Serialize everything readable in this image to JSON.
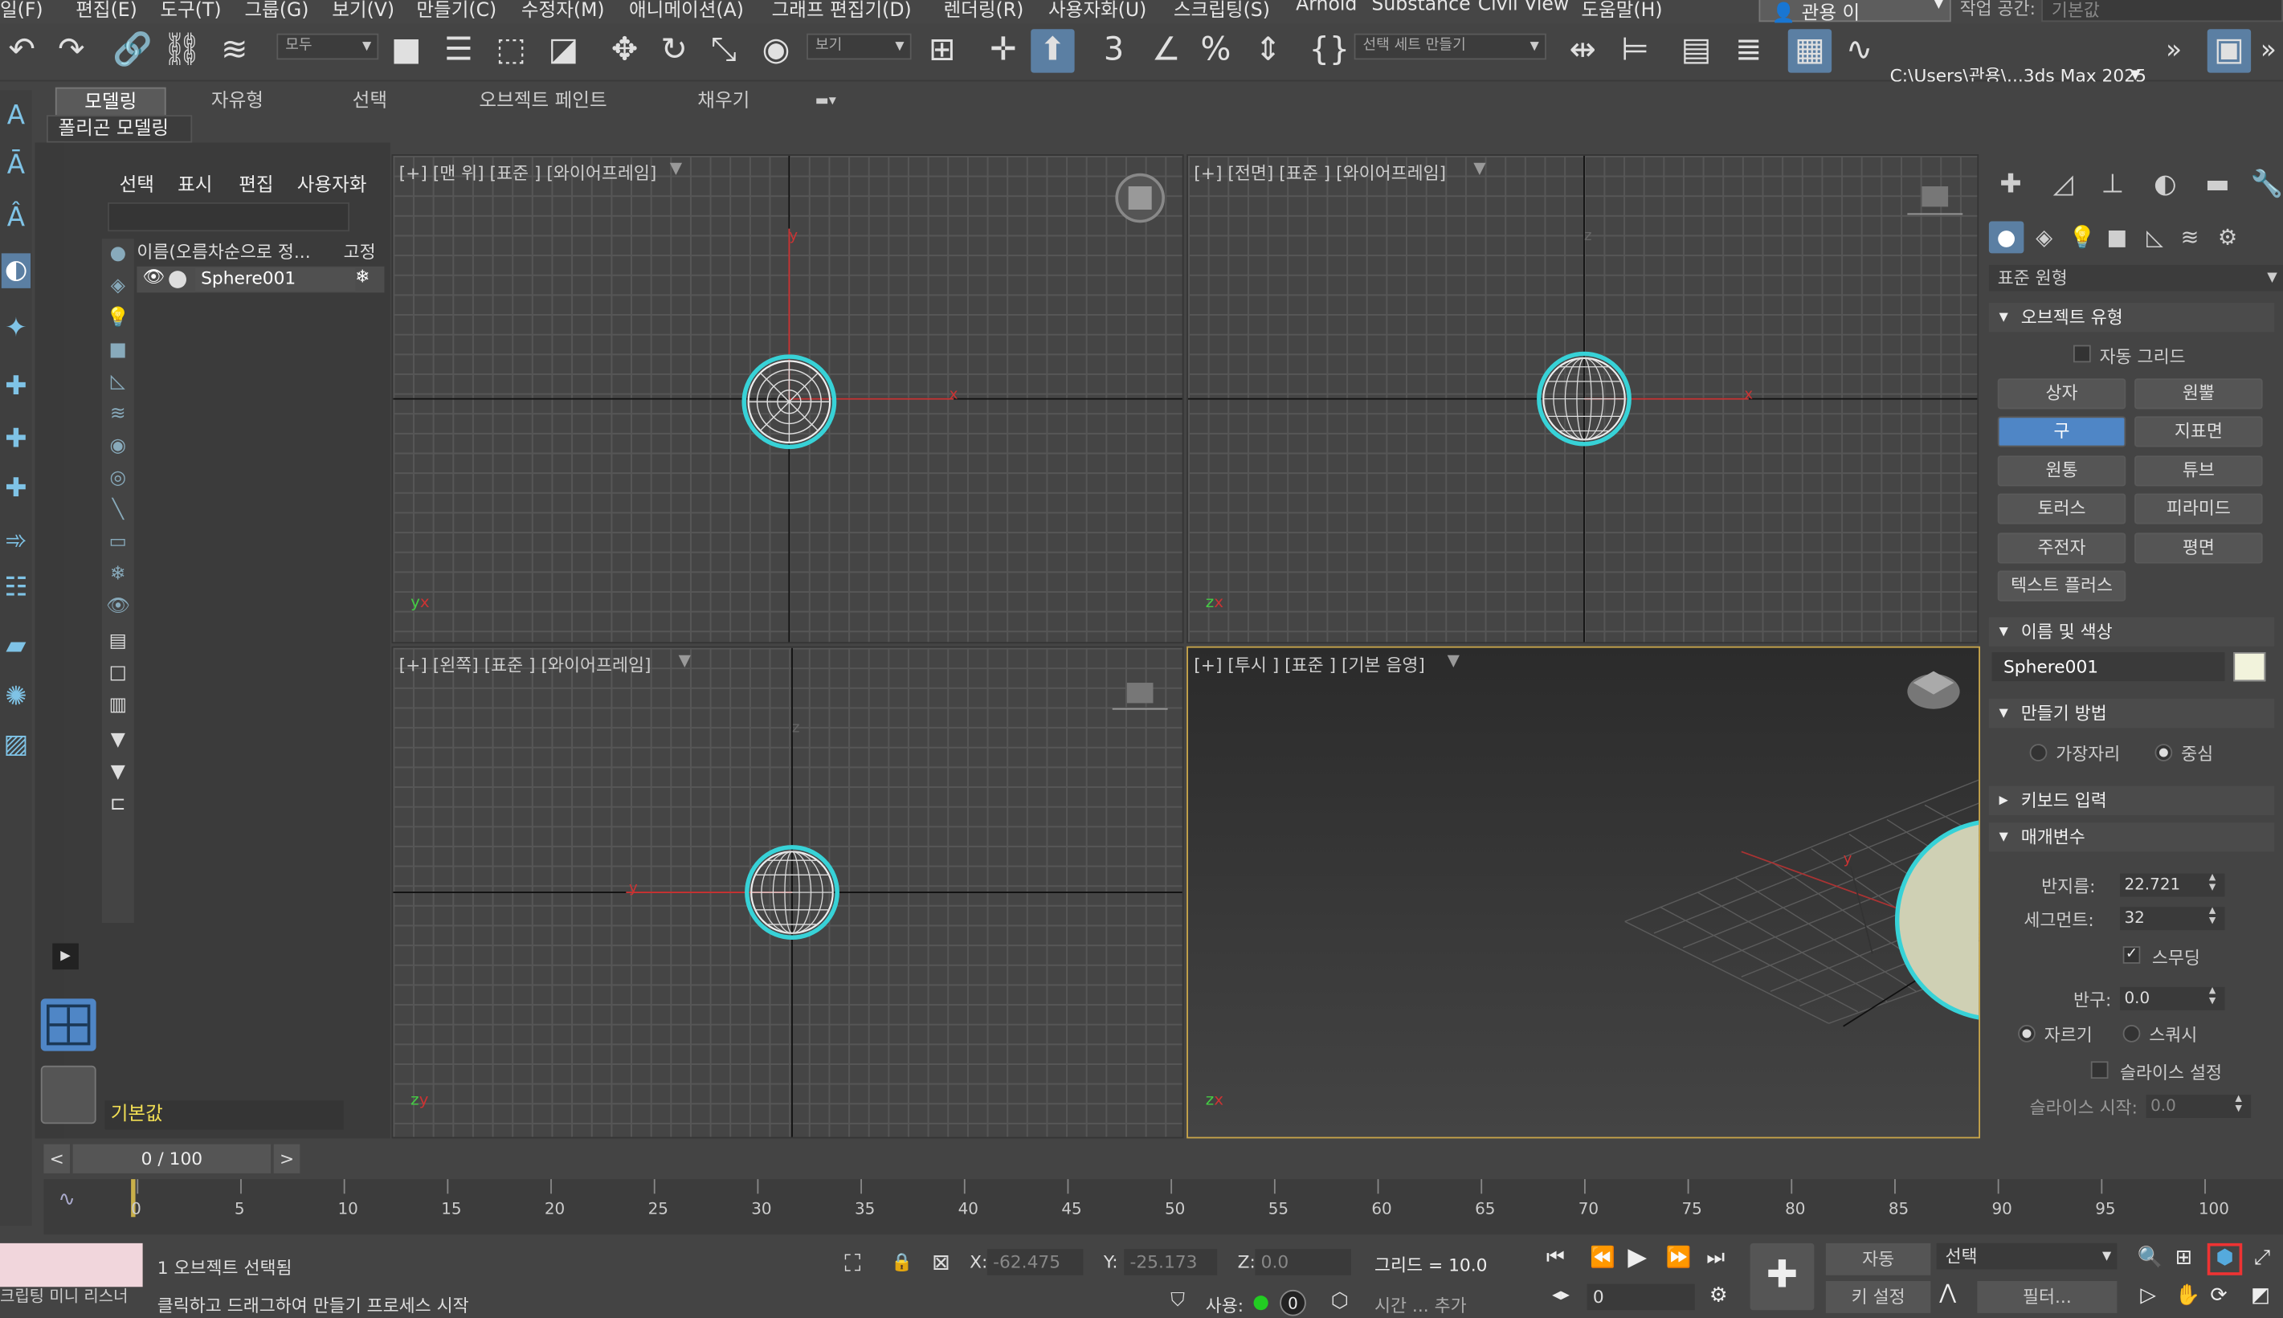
{
  "menubar": {
    "items": [
      "일(F)",
      "편집(E)",
      "도구(T)",
      "그룹(G)",
      "보기(V)",
      "만들기(C)",
      "수정자(M)",
      "애니메이션(A)",
      "그래프 편집기(D)",
      "렌더링(R)",
      "사용자화(U)",
      "스크립팅(S)",
      "Arnold",
      "Substance",
      "Civil View",
      "도움말(H)"
    ],
    "user": "관용 이",
    "workspace_label": "작업 공간:",
    "workspace_value": "기본값"
  },
  "toolbar": {
    "filter_dropdown": "모두",
    "coord_dropdown": "보기",
    "selection_set_dropdown": "선택 세트 만들기",
    "project_path": "C:\\Users\\관용\\...3ds Max 2025"
  },
  "ribbon": {
    "tabs": [
      "모델링",
      "자유형",
      "선택",
      "오브젝트 페인트",
      "채우기"
    ],
    "active_tab": "모델링",
    "sub_panel": "폴리곤 모델링"
  },
  "scene_explorer": {
    "menus": [
      "선택",
      "표시",
      "편집",
      "사용자화"
    ],
    "column_name": "이름(오름차순으로 정...",
    "column_freeze": "고정",
    "rows": [
      {
        "name": "Sphere001"
      }
    ],
    "layer_dropdown": "기본값"
  },
  "viewports": {
    "top": "[+] [맨 위] [표준 ] [와이어프레임]",
    "front": "[+] [전면] [표준 ] [와이어프레임]",
    "left": "[+] [왼쪽] [표준 ] [와이어프레임]",
    "perspective": "[+] [투시 ] [표준 ] [기본 음영]",
    "axis_x": "x",
    "axis_y": "y",
    "axis_z": "z"
  },
  "command_panel": {
    "category_dropdown": "표준 원형",
    "object_type": {
      "header": "오브젝트 유형",
      "autogrid": "자동 그리드",
      "buttons": [
        "상자",
        "원뿔",
        "구",
        "지표면",
        "원통",
        "튜브",
        "토러스",
        "피라미드",
        "주전자",
        "평면",
        "텍스트 플러스"
      ],
      "active": "구"
    },
    "name_color": {
      "header": "이름 및 색상",
      "name": "Sphere001",
      "color": "#f2f3dc"
    },
    "creation_method": {
      "header": "만들기 방법",
      "edge": "가장자리",
      "center": "중심",
      "selected": "중심"
    },
    "keyboard_entry": {
      "header": "키보드 입력"
    },
    "parameters": {
      "header": "매개변수",
      "radius_label": "반지름:",
      "radius": "22.721",
      "segments_label": "세그먼트:",
      "segments": "32",
      "smooth_label": "스무딩",
      "smooth": true,
      "hemisphere_label": "반구:",
      "hemisphere": "0.0",
      "chop": "자르기",
      "squash": "스쿼시",
      "slice_on": "슬라이스 설정",
      "slice_from_label": "슬라이스 시작:",
      "slice_from": "0.0"
    }
  },
  "timeline": {
    "frame_display": "0 / 100",
    "ticks": [
      "0",
      "5",
      "10",
      "15",
      "20",
      "25",
      "30",
      "35",
      "40",
      "45",
      "50",
      "55",
      "60",
      "65",
      "70",
      "75",
      "80",
      "85",
      "90",
      "95",
      "100"
    ]
  },
  "status": {
    "selected": "1 오브젝트 선택됨",
    "prompt": "클릭하고 드래그하여 만들기 프로세스 시작",
    "maxscript": "크립팅 미니 리스너",
    "x_label": "X:",
    "x_value": "-62.475",
    "y_label": "Y:",
    "y_value": "-25.173",
    "z_label": "Z:",
    "z_value": "0.0",
    "grid": "그리드 = 10.0",
    "enable_label": "사용:",
    "time_tag": "시간 ... 추가",
    "auto_key": "자동",
    "set_key": "키 설정",
    "key_mode_dropdown": "선택",
    "filters": "필터...",
    "current_frame": "0",
    "counter": "0"
  }
}
